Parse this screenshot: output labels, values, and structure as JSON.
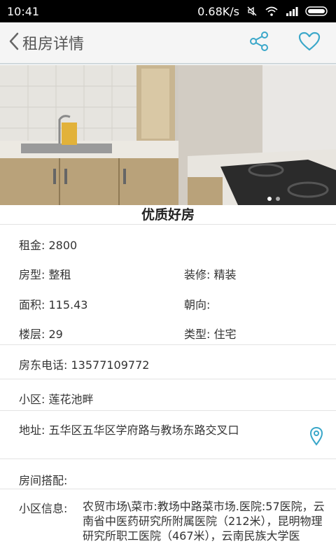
{
  "status_bar": {
    "time": "10:41",
    "speed": "0.68K/s"
  },
  "app_bar": {
    "title": "租房详情"
  },
  "listing": {
    "title": "优质好房",
    "rent": "租金: 2800",
    "type": "房型: 整租",
    "decoration": "装修: 精装",
    "area": "面积: 115.43",
    "orientation": "朝向:",
    "floor": "楼层: 29",
    "category": "类型: 住宅",
    "landlord_phone": "房东电话: 13577109772",
    "community": "小区:  莲花池畔",
    "address": "地址:  五华区五华区学府路与教场东路交叉口",
    "room_features": "房间搭配:",
    "community_info_label": "小区信息:",
    "community_info": "农贸市场\\菜市:教场中路菜市场.医院:57医院，云南省中医药研究所附属医院（212米），昆明物理研究所职工医院（467米），云南民族大学医"
  },
  "colors": {
    "accent": "#3aa7c9"
  }
}
